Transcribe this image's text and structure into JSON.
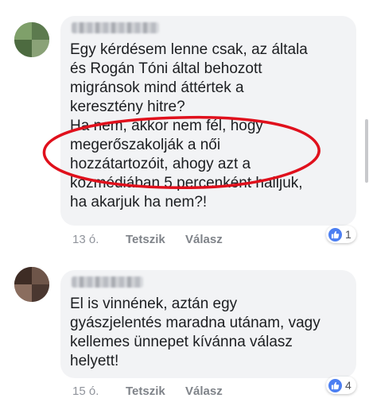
{
  "comments": [
    {
      "text": "Egy kérdésem lenne csak, az általa\nés Rogán Tóni által behozott\nmigránsok mind áttértek a\nkeresztény hitre?\nHa nem, akkor nem fél, hogy\nmegerőszakolják a női\nhozzátartozóit, ahogy azt a\nközmédiában 5 percenként halljuk,\nha akarjuk ha nem?!",
      "time": "13 ó.",
      "like_label": "Tetszik",
      "reply_label": "Válasz",
      "reaction_count": "1",
      "reaction_icon": "like-icon",
      "reaction_color": "#4c7ff2"
    },
    {
      "text": "El is vinnének, aztán egy\ngyászjelentés maradna utánam, vagy\nkellemes ünnepet kívánna válasz\nhelyett!",
      "time": "15 ó.",
      "like_label": "Tetszik",
      "reply_label": "Válasz",
      "reaction_count": "4",
      "reaction_icon": "like-icon",
      "reaction_color": "#4c7ff2"
    }
  ],
  "highlight_color": "#e0101c"
}
